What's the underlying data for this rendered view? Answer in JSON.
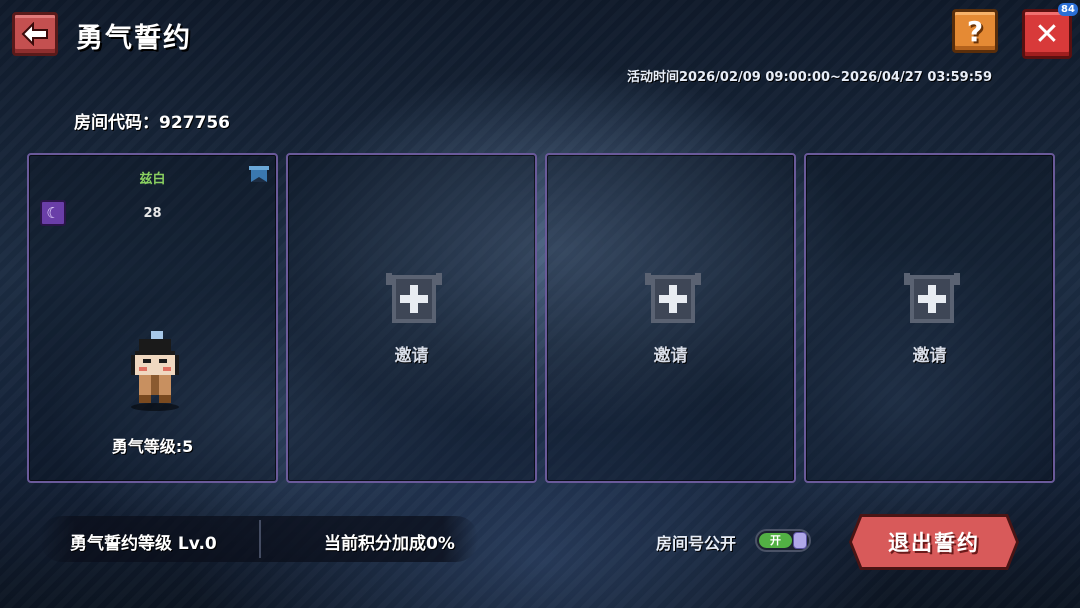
{
  "header": {
    "title": "勇气誓约",
    "help_label": "?",
    "close_label": "✕",
    "fps": "84"
  },
  "event": {
    "time": "活动时间2026/02/09 09:00:00~2026/04/27 03:59:59"
  },
  "room": {
    "code_text": "房间代码：927756"
  },
  "slots": {
    "player": {
      "name": "兹白",
      "level": "28",
      "class_icon": "moon-icon",
      "courage_level": "勇气等级:5"
    },
    "invite_label": "邀请",
    "empty_count_shown": 3
  },
  "footer": {
    "pact_level": "勇气誓约等级 Lv.0",
    "score_bonus": "当前积分加成0%",
    "room_public_label": "房间号公开",
    "toggle_on_label": "开",
    "exit_label": "退出誓约"
  },
  "colors": {
    "accent_red": "#d85a5a",
    "slot_border": "#6a5a9a",
    "player_name": "#8ad060",
    "toggle_on": "#52b044",
    "help_orange": "#e58a34"
  }
}
